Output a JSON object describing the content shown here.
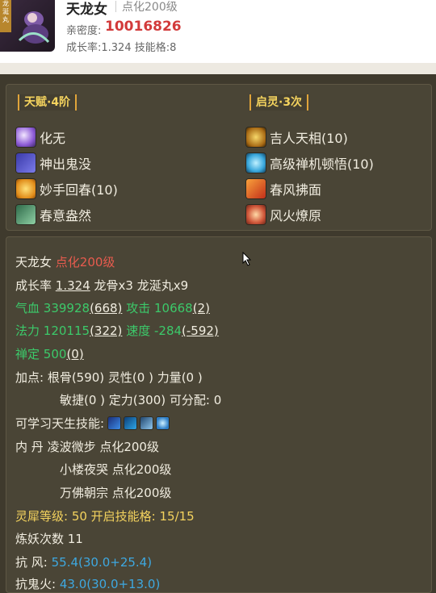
{
  "header": {
    "name": "天龙女",
    "level": "点化200级",
    "intimacy_label": "亲密度:",
    "intimacy": "10016826",
    "growth_line": "成长率:1.324 技能格:8",
    "avatar_tag": "龙涎丸"
  },
  "talent": {
    "title": "天赋·4阶",
    "items": [
      "化无",
      "神出鬼没",
      "妙手回春(10)",
      "春意盎然"
    ]
  },
  "inspire": {
    "title": "启灵·3次",
    "items": [
      "吉人天相(10)",
      "高级禅机顿悟(10)",
      "春风拂面",
      "风火燎原"
    ]
  },
  "detail": {
    "name": "天龙女",
    "level": "点化200级",
    "growth_label": "成长率",
    "growth_value": "1.324",
    "growth_extra": "龙骨x3 龙涎丸x9",
    "hp_label": "气血",
    "hp_value": "339928",
    "hp_bonus": "(668)",
    "atk_label": "攻击",
    "atk_value": "10668",
    "atk_bonus": "(2)",
    "mp_label": "法力",
    "mp_value": "120115",
    "mp_bonus": "(322)",
    "spd_label": "速度",
    "spd_value": "-284",
    "spd_bonus": "(-592)",
    "zen_label": "禅定",
    "zen_value": "500",
    "zen_bonus": "(0)",
    "points_line1": "加点:  根骨(590) 灵性(0 ) 力量(0 )",
    "points_line2": "敏捷(0 ) 定力(300) 可分配:  0",
    "learnable_label": "可学习天生技能:",
    "neidan_label": "内    丹",
    "neidan": [
      "凌波微步 点化200级",
      "小楼夜哭 点化200级",
      "万佛朝宗 点化200级"
    ],
    "rhino_line": "灵犀等级:  50 开启技能格:  15/15",
    "refine_line": "炼妖次数 11",
    "resist_wind_label": "抗    风:",
    "resist_wind_value": "55.4(30.0+25.4)",
    "resist_ghostfire_label": "抗鬼火:",
    "resist_ghostfire_value": "43.0(30.0+13.0)"
  },
  "colors": {
    "bg": "#3f3a2d",
    "panel": "#4a4536",
    "gold": "#f4d35e",
    "red": "#e85b4e",
    "green": "#3cc96a",
    "cyan": "#3ea8e0"
  }
}
